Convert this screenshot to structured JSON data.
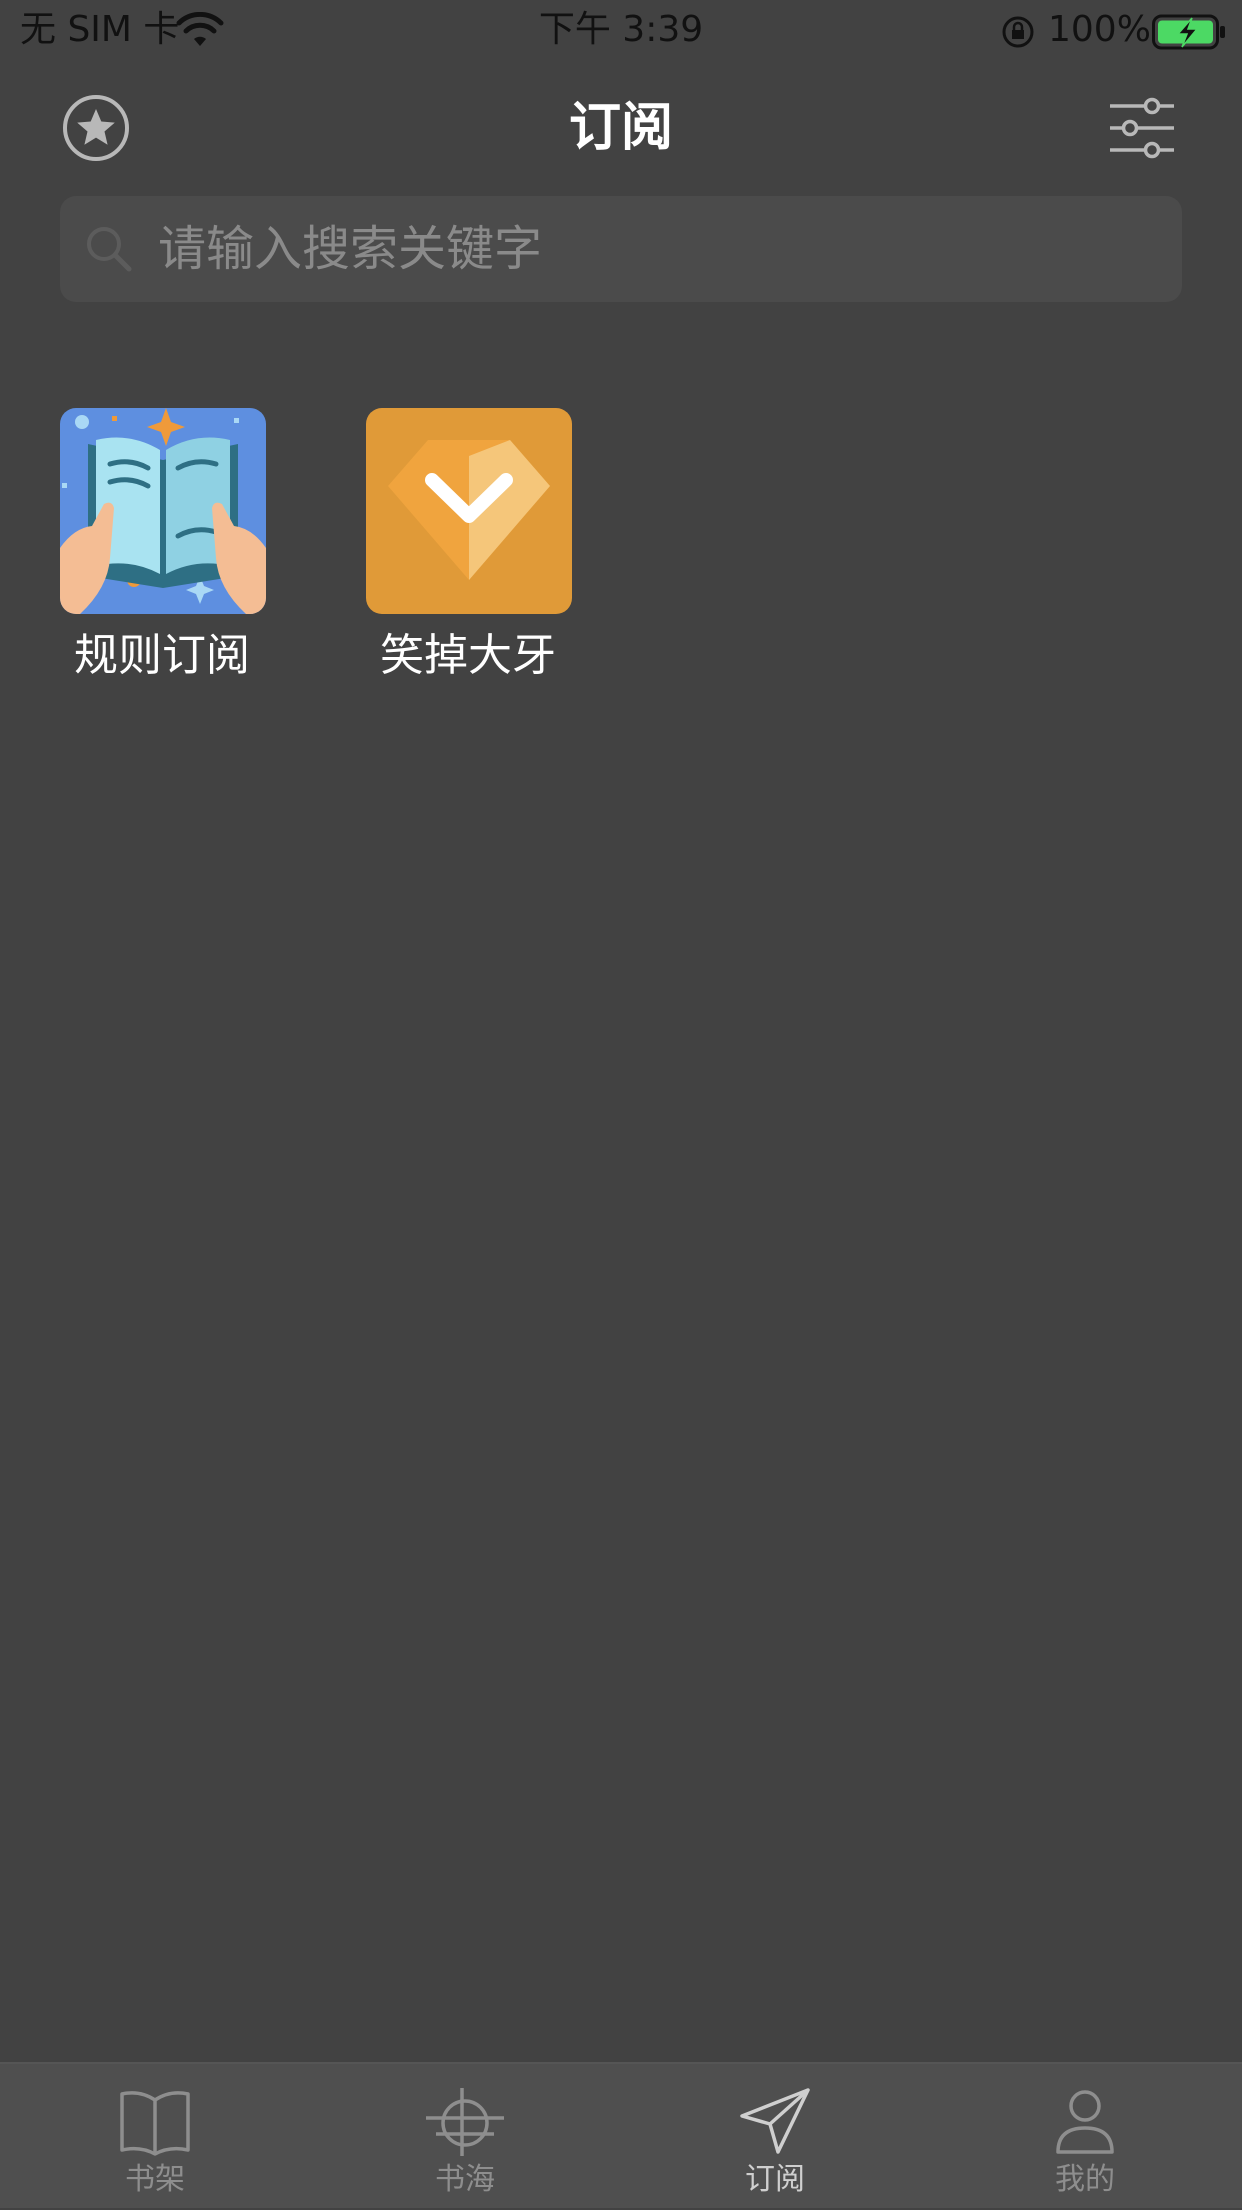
{
  "status_bar": {
    "carrier": "无 SIM 卡",
    "time": "下午 3:39",
    "battery_percent": "100%"
  },
  "nav": {
    "title": "订阅",
    "left_icon": "star-icon",
    "right_icon": "filter-sliders-icon"
  },
  "search": {
    "placeholder": "请输入搜索关键字",
    "value": ""
  },
  "items": [
    {
      "label": "规则订阅",
      "icon": "open-book-icon"
    },
    {
      "label": "笑掉大牙",
      "icon": "diamond-check-icon"
    }
  ],
  "tabbar": {
    "tabs": [
      {
        "label": "书架",
        "icon": "book-icon",
        "active": false
      },
      {
        "label": "书海",
        "icon": "compass-grid-icon",
        "active": false
      },
      {
        "label": "订阅",
        "icon": "send-icon",
        "active": true
      },
      {
        "label": "我的",
        "icon": "person-icon",
        "active": false
      }
    ]
  },
  "colors": {
    "background": "#424242",
    "search_background": "#4b4b4b",
    "tabbar_background": "#4f4f4f",
    "accent_orange": "#e09a38",
    "book_tile_blue": "#5e8fe0"
  }
}
